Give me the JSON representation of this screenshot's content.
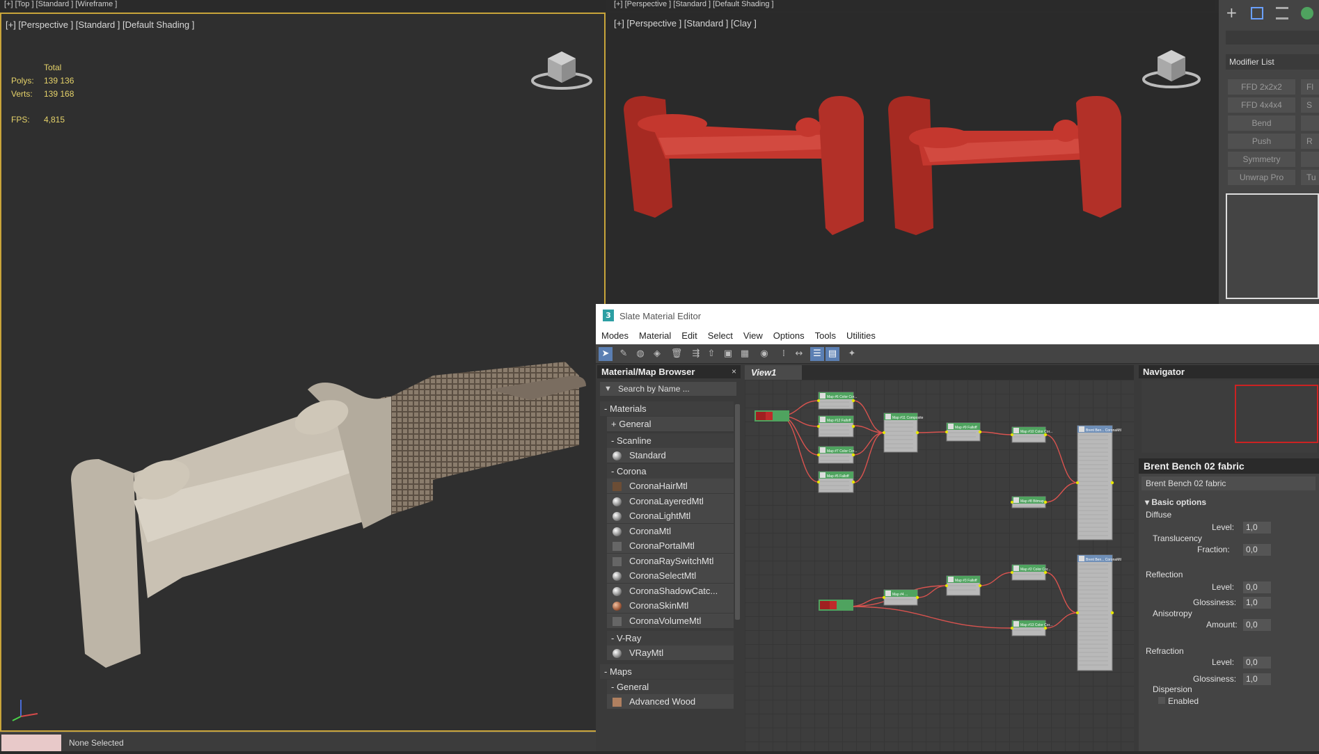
{
  "top_strip": {
    "left": "[+] [Top ] [Standard ] [Wireframe ]",
    "right": "[+] [Perspective ] [Standard ] [Default Shading ]"
  },
  "viewport_left": {
    "label": "[+] [Perspective ] [Standard ] [Default Shading ]",
    "stats": {
      "total_label": "Total",
      "polys_label": "Polys:",
      "polys_value": "139 136",
      "verts_label": "Verts:",
      "verts_value": "139 168",
      "fps_label": "FPS:",
      "fps_value": "4,815"
    }
  },
  "viewport_right": {
    "label": "[+] [Perspective ] [Standard ] [Clay ]"
  },
  "command_panel": {
    "modifier_list": "Modifier List",
    "buttons": [
      "FFD 2x2x2",
      "FFD 4x4x4",
      "Bend",
      "Push",
      "Symmetry",
      "Unwrap Pro"
    ],
    "buttons_right": [
      "Fl",
      "S",
      "",
      "R",
      "",
      "Tu"
    ]
  },
  "status_bar": {
    "selection": "None Selected"
  },
  "slate_editor": {
    "title": "Slate Material Editor",
    "menu": [
      "Modes",
      "Material",
      "Edit",
      "Select",
      "View",
      "Options",
      "Tools",
      "Utilities"
    ],
    "browser": {
      "title": "Material/Map Browser",
      "close": "×",
      "search_placeholder": "Search by Name ...",
      "materials_header": "- Materials",
      "general": "+ General",
      "scanline": "- Scanline",
      "standard": "Standard",
      "corona": "- Corona",
      "corona_items": [
        "CoronaHairMtl",
        "CoronaLayeredMtl",
        "CoronaLightMtl",
        "CoronaMtl",
        "CoronaPortalMtl",
        "CoronaRaySwitchMtl",
        "CoronaSelectMtl",
        "CoronaShadowCatc...",
        "CoronaSkinMtl",
        "CoronaVolumeMtl"
      ],
      "vray": "- V-Ray",
      "vray_item": "VRayMtl",
      "maps_header": "- Maps",
      "maps_general": "- General",
      "advanced_wood": "Advanced Wood"
    },
    "view_tab": "View1",
    "navigator": "Navigator",
    "properties": {
      "title": "Brent Bench 02 fabric",
      "name_field": "Brent Bench 02 fabric",
      "basic_options": "Basic options",
      "diffuse": "Diffuse",
      "level_label": "Level:",
      "diffuse_level": "1,0",
      "translucency": "Translucency",
      "fraction_label": "Fraction:",
      "fraction_value": "0,0",
      "reflection": "Reflection",
      "reflection_level": "0,0",
      "glossiness_label": "Glossiness:",
      "reflection_gloss": "1,0",
      "anisotropy": "Anisotropy",
      "amount_label": "Amount:",
      "anisotropy_amount": "0,0",
      "refraction": "Refraction",
      "refraction_level": "0,0",
      "refraction_gloss": "1,0",
      "dispersion": "Dispersion",
      "enabled": "Enabled"
    },
    "nodes": [
      {
        "label": "Map #6 Color Cor..."
      },
      {
        "label": "Map #12 Falloff"
      },
      {
        "label": "Map #7 Color Cor..."
      },
      {
        "label": "Map #5 Falloff"
      },
      {
        "label": "Map #11 Composite"
      },
      {
        "label": "Map #9 Falloff"
      },
      {
        "label": "Map #10 Color Cor..."
      },
      {
        "label": "Brent Ben... CoronaMtl"
      },
      {
        "label": "Map #8 Bitmap"
      },
      {
        "label": "Map #3 Falloff"
      },
      {
        "label": "Map #2 Color Cor..."
      },
      {
        "label": "Map #4 ..."
      },
      {
        "label": "Map #13 Color Cor..."
      },
      {
        "label": "Brent Ben... CoronaMtl"
      }
    ]
  },
  "colors": {
    "bench_clay": "#b8312a",
    "bench_fabric": "#cfc7b8",
    "node_header": "#4fa35f",
    "wire": "#d9534f"
  }
}
